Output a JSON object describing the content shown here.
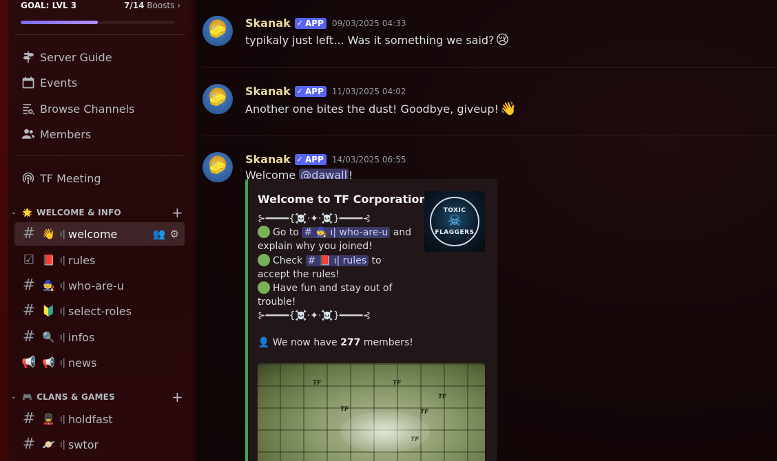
{
  "sidebar": {
    "goal": {
      "title": "GOAL: LVL 3",
      "boosts_count": "7/14",
      "boosts_label": "Boosts",
      "chevron": "›",
      "progress": 0.5
    },
    "nav": [
      {
        "label": "Server Guide",
        "icon": "signpost-icon"
      },
      {
        "label": "Events",
        "icon": "calendar-icon"
      },
      {
        "label": "Browse Channels",
        "icon": "browse-channels-icon"
      },
      {
        "label": "Members",
        "icon": "members-icon"
      }
    ],
    "stage": {
      "label": "TF Meeting",
      "icon": "stage-icon"
    },
    "categories": [
      {
        "emoji": "🌟",
        "name": "WELCOME & INFO",
        "chevron": "⌄",
        "add": "+"
      },
      {
        "emoji": "🎮",
        "name": "CLANS & GAMES",
        "chevron": "⌄",
        "add": "+"
      }
    ],
    "channels": [
      {
        "prefix": "#",
        "emoji": "👋",
        "sep": "ı|",
        "name": "welcome"
      },
      {
        "prefix": "☑",
        "emoji": "📕",
        "sep": "ı|",
        "name": "rules"
      },
      {
        "prefix": "#",
        "emoji": "🧙",
        "sep": "ı|",
        "name": "who-are-u"
      },
      {
        "prefix": "#",
        "emoji": "🔰",
        "sep": "ı|",
        "name": "select-roles"
      },
      {
        "prefix": "#",
        "emoji": "🔍",
        "sep": "ı|",
        "name": "infos"
      },
      {
        "prefix": "📢",
        "emoji": "📢",
        "sep": "ı|",
        "name": "news"
      },
      {
        "prefix": "#",
        "emoji": "💂",
        "sep": "ı|",
        "name": "holdfast"
      },
      {
        "prefix": "#",
        "emoji": "🪐",
        "sep": "ı|",
        "name": "swtor"
      }
    ]
  },
  "messages": [
    {
      "author": "Skanak",
      "tag": "APP",
      "check": "✓",
      "timestamp": "09/03/2025 04:33",
      "text": "typikaly just left... Was it something we said?",
      "emoji": "😢"
    },
    {
      "author": "Skanak",
      "tag": "APP",
      "check": "✓",
      "timestamp": "11/03/2025 04:02",
      "text": "Another one bites the dust! Goodbye, giveup!",
      "emoji": "👋"
    },
    {
      "author": "Skanak",
      "tag": "APP",
      "check": "✓",
      "timestamp": "14/03/2025 06:55",
      "text_before": "Welcome ",
      "mention": "@dawall",
      "text_after": "!"
    }
  ],
  "embed": {
    "title": "Welcome to TF Corporation!",
    "divider": "⊱━━━━{☠️·✦·☠️}━━━━⊰",
    "go_to": "Go to",
    "who_are_u_mention": "# 🧙 ı| who-are-u",
    "and_explain": "and explain why you joined!",
    "check": "Check",
    "rules_mention": "# 📕 ı| rules",
    "to_accept": "to accept the rules!",
    "have_fun": "Have fun and stay out of trouble!",
    "members_prefix": "We now have",
    "members_count": "277",
    "members_suffix": "members!",
    "members_emoji": "👤",
    "thumb_top": "TOXIC",
    "thumb_bottom": "FLAGGERS",
    "image_mark": "TF"
  },
  "colors": {
    "accent": "#5865f2",
    "embed_border": "#3ba55c",
    "author": "#e9d9a4"
  }
}
